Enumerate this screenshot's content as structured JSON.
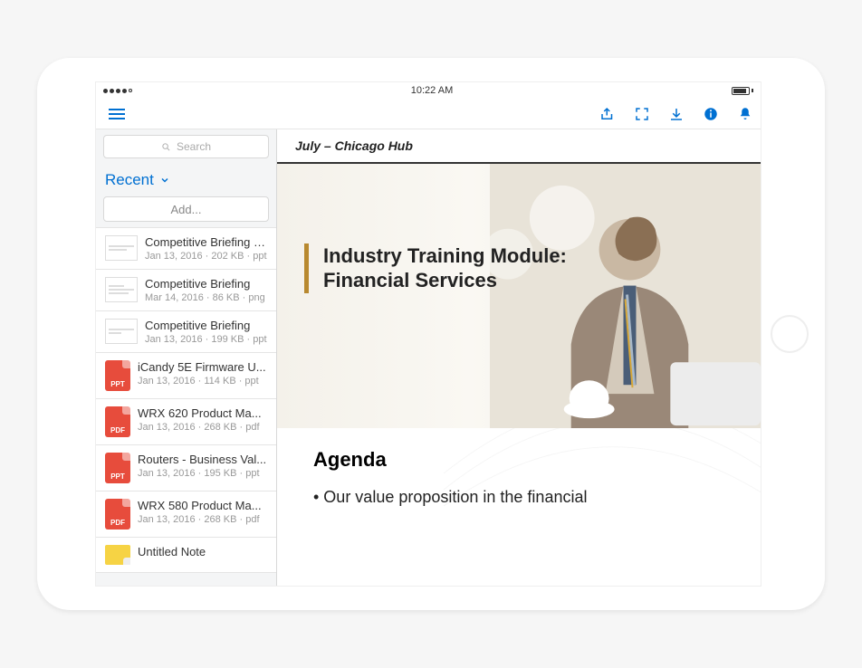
{
  "statusbar": {
    "time": "10:22 AM"
  },
  "sidebar": {
    "search_placeholder": "Search",
    "section_label": "Recent",
    "add_label": "Add...",
    "items": [
      {
        "title": "Competitive Briefing -...",
        "meta": "Jan 13, 2016 · 202 KB · ppt",
        "kind": "preview"
      },
      {
        "title": "Competitive Briefing",
        "meta": "Mar 14, 2016 · 86 KB · png",
        "kind": "preview"
      },
      {
        "title": "Competitive Briefing",
        "meta": "Jan 13, 2016 · 199 KB · ppt",
        "kind": "preview"
      },
      {
        "title": "iCandy 5E Firmware U...",
        "meta": "Jan 13, 2016 · 114 KB · ppt",
        "kind": "ppt"
      },
      {
        "title": "WRX 620 Product Ma...",
        "meta": "Jan 13, 2016 · 268 KB · pdf",
        "kind": "pdf"
      },
      {
        "title": "Routers - Business Val...",
        "meta": "Jan 13, 2016 · 195 KB · ppt",
        "kind": "ppt"
      },
      {
        "title": "WRX 580 Product Ma...",
        "meta": "Jan 13, 2016 · 268 KB · pdf",
        "kind": "pdf"
      },
      {
        "title": "Untitled Note",
        "meta": "",
        "kind": "note"
      }
    ]
  },
  "document": {
    "header": "July – Chicago Hub",
    "slide1_line1": "Industry Training Module:",
    "slide1_line2": "Financial Services",
    "slide2_heading": "Agenda",
    "slide2_bullet": "• Our value proposition in the financial"
  }
}
